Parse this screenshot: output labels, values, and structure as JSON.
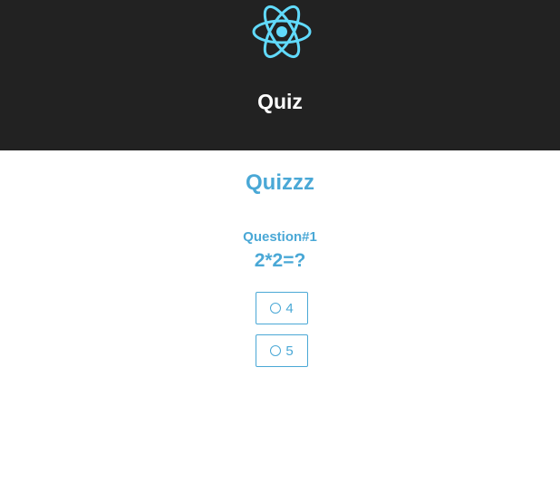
{
  "header": {
    "title": "Quiz",
    "logo_icon": "react-atom-icon",
    "background_color": "#222222",
    "logo_color": "#61dafb"
  },
  "quiz": {
    "title": "Quizzz",
    "accent_color": "#4aa8d6",
    "question": {
      "number_label": "Question#1",
      "text": "2*2=?"
    },
    "options": [
      {
        "label": "4",
        "icon": "radio-unchecked-icon"
      },
      {
        "label": "5",
        "icon": "radio-unchecked-icon"
      }
    ]
  }
}
